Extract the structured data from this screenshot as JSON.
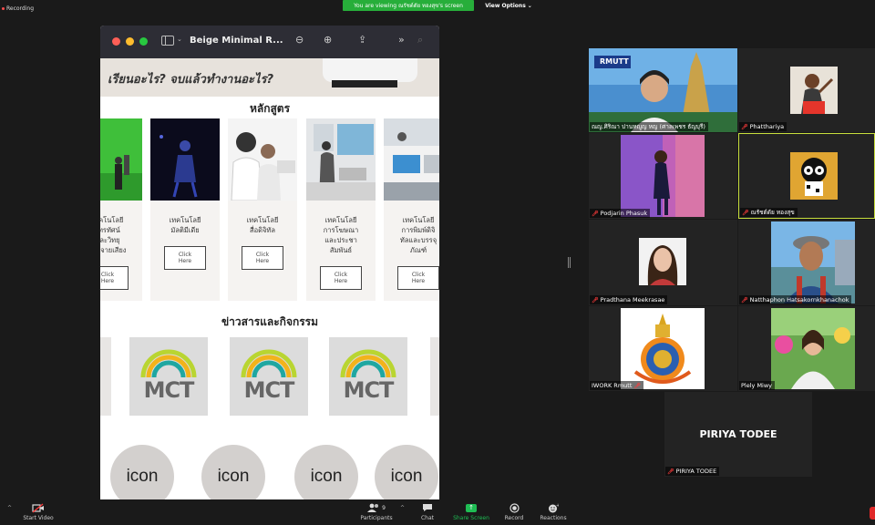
{
  "topbar": {
    "recording": "Recording",
    "viewing_banner": "You are viewing ณรัชต์ดัย ทองสุข's screen",
    "view_options": "View Options"
  },
  "share_window": {
    "title": "Beige Minimal R...",
    "page": {
      "hero_text": "เรียนอะไร? จบแล้วทำงานอะไร?",
      "courses_heading": "หลักสูตร",
      "courses": [
        {
          "label": "เทคโนโลยี\nไทรทัศน์\nและวิทยุ\nกระจายเสียง",
          "button": "Click\nHere"
        },
        {
          "label": "เทคโนโลยี\nมัลติมีเดีย",
          "button": "Click\nHere"
        },
        {
          "label": "เทคโนโลยี\nสื่อดิจิทัล",
          "button": "Click\nHere"
        },
        {
          "label": "เทคโนโลยี\nการโฆษณา\nและประชา\nสัมพันธ์",
          "button": "Click\nHere"
        },
        {
          "label": "เทคโนโลยี\nการพิมพ์ดิจิ\nทัลและบรรจุ\nภัณฑ์",
          "button": "Click\nHere"
        }
      ],
      "news_heading": "ข่าวสารและกิจกรรม",
      "news_logo": "MCT",
      "icon_label": "icon"
    }
  },
  "participants": [
    {
      "name": "ณญ.ศิริณา ปานหญูญ หญ (ศาลเพชร ธัญบุรี)",
      "muted": false,
      "logo": "RMUTT"
    },
    {
      "name": "Phatthariya",
      "muted": true
    },
    {
      "name": "Podjarin Phasuk",
      "muted": true
    },
    {
      "name": "ณรัชต์ดัย ทองสุข",
      "muted": true,
      "active": true
    },
    {
      "name": "Pradthana Meekrasae",
      "muted": true
    },
    {
      "name": "Natthaphon Hatsakornkhanachok",
      "muted": true
    },
    {
      "name": "IWORK Rmutt",
      "muted": true
    },
    {
      "name": "Plely Miwy",
      "muted": false
    },
    {
      "name": "PIRIYA TODEE",
      "muted": true,
      "initials_label": "PIRIYA TODEE"
    }
  ],
  "bottombar": {
    "start_video": "Start Video",
    "participants": "Participants",
    "participants_count": "9",
    "chat": "Chat",
    "share_screen": "Share Screen",
    "record": "Record",
    "reactions": "Reactions"
  },
  "colors": {
    "banner_green": "#27ae3a",
    "active_speaker": "#c8df3d",
    "share_green": "#1fbd54",
    "leave_red": "#e02828"
  },
  "icons": [
    "video-off-icon",
    "participants-icon",
    "chat-icon",
    "share-screen-icon",
    "record-icon",
    "reactions-icon",
    "mic-muted-icon",
    "sidebar-icon",
    "zoom-out-icon",
    "zoom-in-icon",
    "share-icon",
    "forward-icon",
    "search-icon"
  ]
}
